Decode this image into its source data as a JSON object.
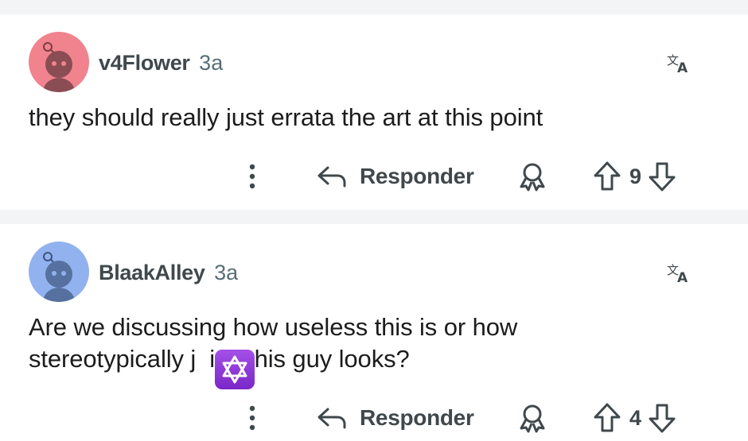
{
  "comments": [
    {
      "username": "v4Flower",
      "age": "3a",
      "text": "they should really just errata the art at this point",
      "reply_label": "Responder",
      "score": "9",
      "avatar_color": "#f0838d"
    },
    {
      "username": "BlaakAlley",
      "age": "3a",
      "text_line1": "Are we discussing how useless this is or how",
      "text_line2": "stereotypically j  ish this guy looks?",
      "reply_label": "Responder",
      "score": "4",
      "avatar_color": "#92b1ef"
    }
  ],
  "icons": {
    "translate": "translate-icon",
    "more": "more-vertical-icon",
    "reply": "reply-arrow-icon",
    "award": "award-icon",
    "upvote": "upvote-arrow-icon",
    "downvote": "downvote-arrow-icon",
    "emoji": "star-of-david-emoji"
  },
  "colors": {
    "separator": "#f3f4f6",
    "meta_text": "#576f76",
    "action_text": "#40484c",
    "emoji_purple": "#8b35d6"
  }
}
